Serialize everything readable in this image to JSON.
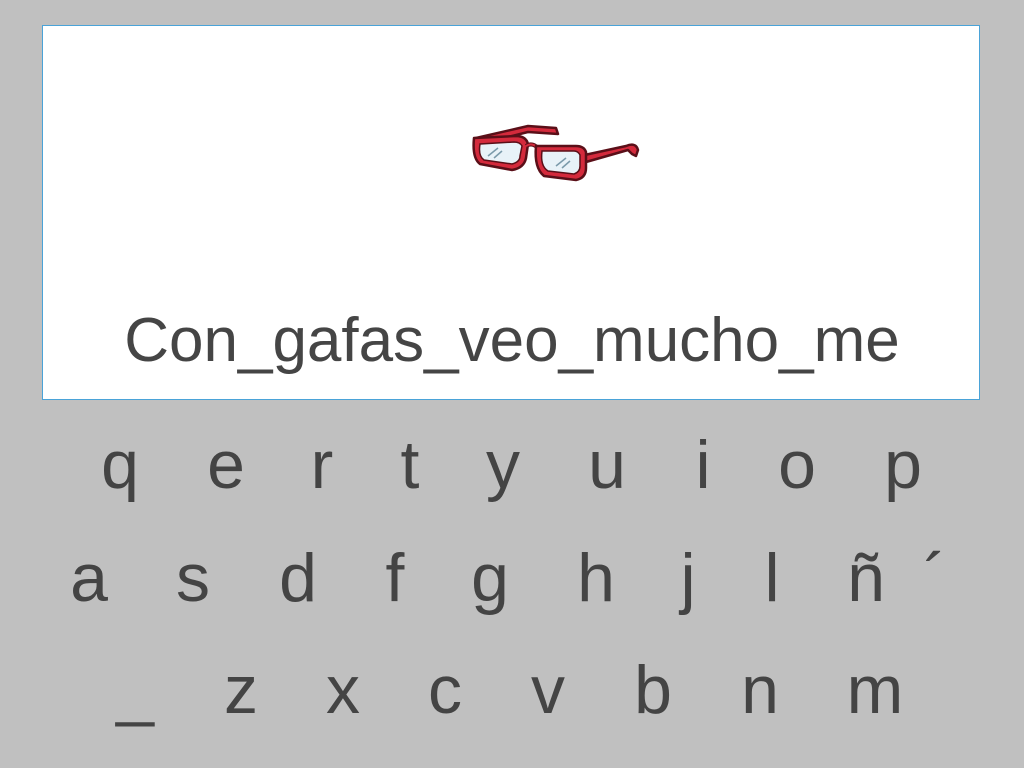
{
  "prompt": {
    "image_icon": "glasses-icon",
    "sentence": "Con_gafas_veo_mucho_me"
  },
  "keyboard": {
    "row1": [
      "q",
      "e",
      "r",
      "t",
      "y",
      "u",
      "i",
      "o",
      "p"
    ],
    "row2": [
      "a",
      "s",
      "d",
      "f",
      "g",
      "h",
      "j",
      "l",
      "ñ",
      "´"
    ],
    "row3": [
      "_",
      "z",
      "x",
      "c",
      "v",
      "b",
      "n",
      "m"
    ]
  },
  "colors": {
    "background": "#c0c0c0",
    "card": "#ffffff",
    "card_border": "#4aa3d8",
    "text": "#444444",
    "glasses_frame": "#d42a3c"
  }
}
